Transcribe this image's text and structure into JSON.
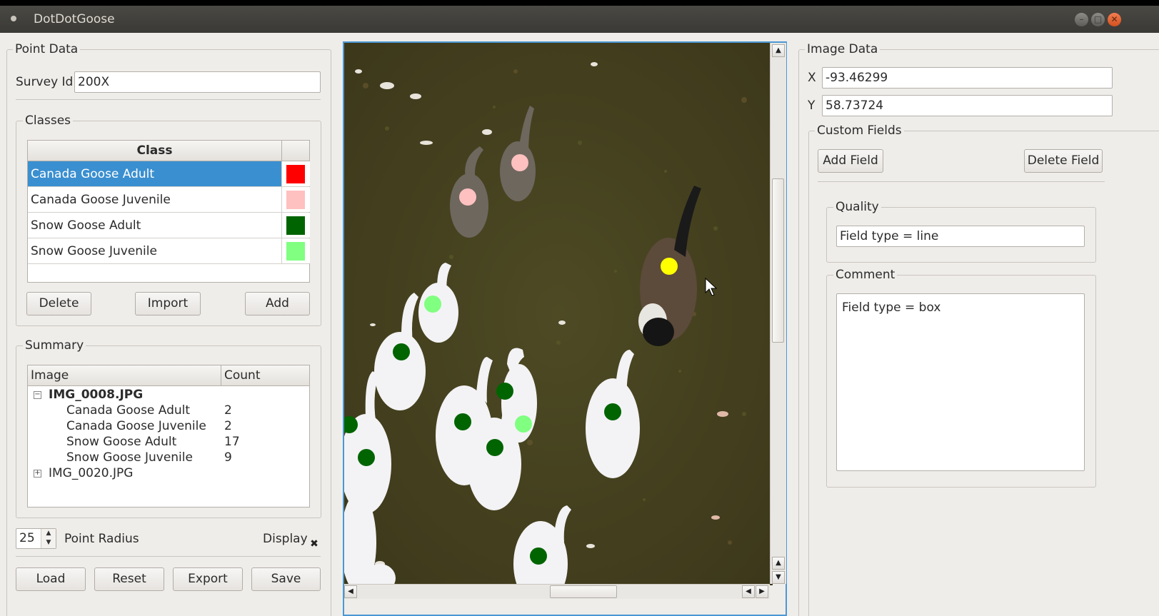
{
  "window": {
    "title": "DotDotGoose"
  },
  "point_data": {
    "title": "Point Data",
    "survey_id_label": "Survey Id",
    "survey_id_value": "200X"
  },
  "classes": {
    "title": "Classes",
    "header_class": "Class",
    "items": [
      {
        "name": "Canada Goose Adult",
        "color": "#ff0000",
        "selected": true
      },
      {
        "name": "Canada Goose Juvenile",
        "color": "#ffc0c0",
        "selected": false
      },
      {
        "name": "Snow Goose Adult",
        "color": "#006400",
        "selected": false
      },
      {
        "name": "Snow Goose Juvenile",
        "color": "#80ff80",
        "selected": false
      }
    ],
    "delete_label": "Delete",
    "import_label": "Import",
    "add_label": "Add"
  },
  "summary": {
    "title": "Summary",
    "header_image": "Image",
    "header_count": "Count",
    "images": [
      {
        "name": "IMG_0008.JPG",
        "expanded": true,
        "rows": [
          {
            "name": "Canada Goose Adult",
            "count": "2"
          },
          {
            "name": "Canada Goose Juvenile",
            "count": "2"
          },
          {
            "name": "Snow Goose Adult",
            "count": "17"
          },
          {
            "name": "Snow Goose Juvenile",
            "count": "9"
          }
        ]
      },
      {
        "name": "IMG_0020.JPG",
        "expanded": false
      }
    ]
  },
  "point_radius": {
    "value": "25",
    "label": "Point Radius",
    "display_label": "Display",
    "display_checked": true
  },
  "actions": {
    "load": "Load",
    "reset": "Reset",
    "export": "Export",
    "save": "Save"
  },
  "image_data": {
    "title": "Image Data",
    "x_label": "X",
    "x_value": "-93.46299",
    "y_label": "Y",
    "y_value": "58.73724",
    "custom_fields_title": "Custom Fields",
    "add_field_label": "Add Field",
    "delete_field_label": "Delete Field",
    "quality_title": "Quality",
    "quality_value": "Field type = line",
    "comment_title": "Comment",
    "comment_value": "Field type = box"
  },
  "colors": {
    "selection": "#3a8fd0",
    "focus_border": "#4b98d4",
    "ground": "#4a4a22",
    "canada_adult_point": "#ffff00"
  }
}
